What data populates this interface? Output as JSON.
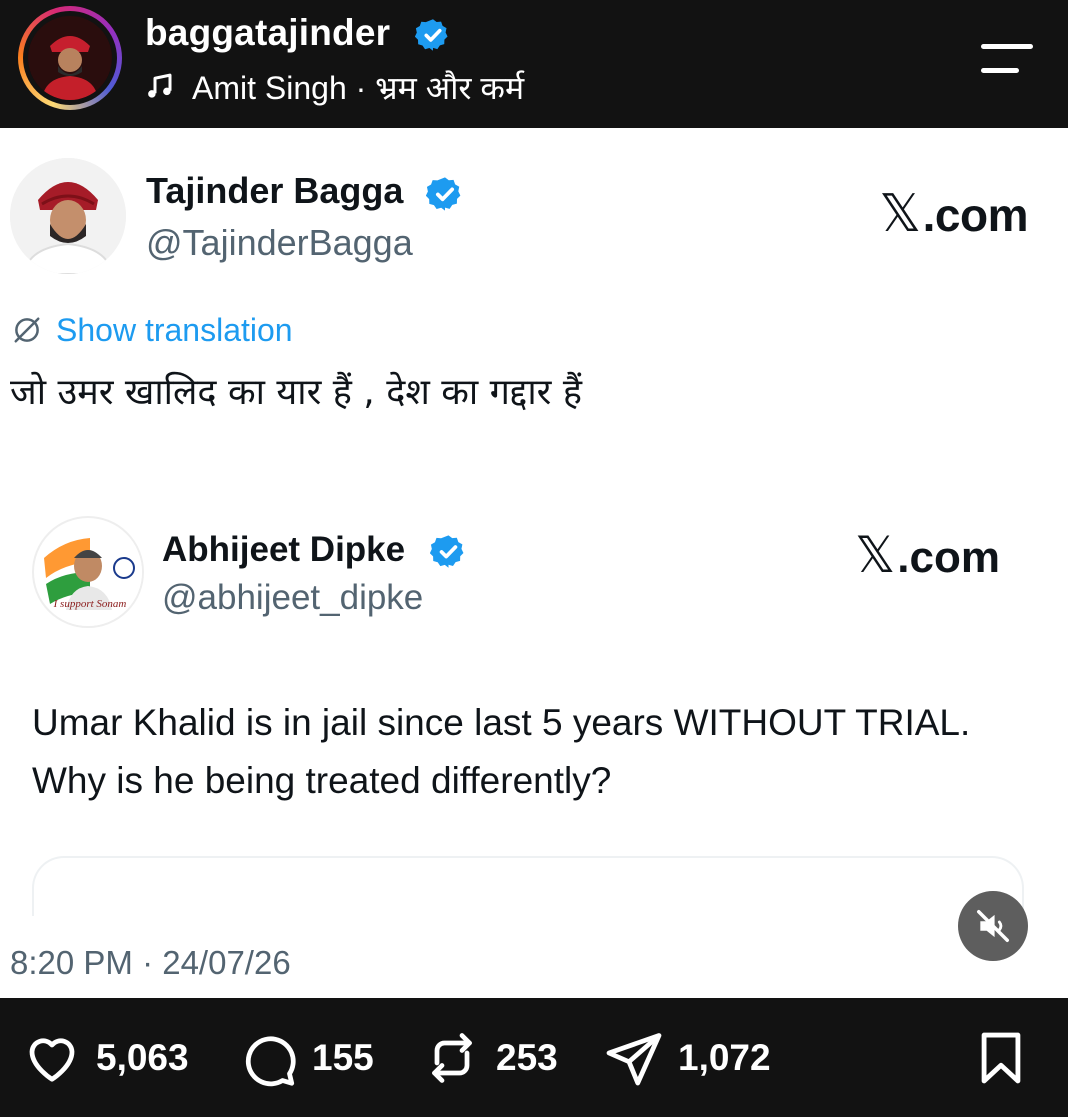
{
  "header": {
    "username": "baggatajinder",
    "music_text": "Amit Singh · भ्रम और कर्म"
  },
  "tweet": {
    "author_name": "Tajinder Bagga",
    "author_handle": "@TajinderBagga",
    "platform_label": "X.com",
    "show_translation_label": "Show translation",
    "text": "जो उमर खालिद का यार हैं , देश का गद्दार हैं",
    "timestamp": "8:20 PM · 24/07/26"
  },
  "quoted_tweet": {
    "author_name": "Abhijeet Dipke",
    "author_handle": "@abhijeet_dipke",
    "platform_label": "X.com",
    "avatar_caption": "I support Sonam",
    "text": "Umar Khalid is in jail since last 5 years WITHOUT TRIAL. Why is he being treated differently?"
  },
  "actions": {
    "likes": "5,063",
    "comments": "155",
    "reposts": "253",
    "shares": "1,072"
  },
  "icons": {
    "verified": "verified-badge-icon",
    "music": "music-note-icon",
    "menu": "hamburger-menu-icon",
    "translate": "translate-globe-icon",
    "mute": "speaker-muted-icon",
    "like": "heart-icon",
    "comment": "comment-bubble-icon",
    "repost": "repost-icon",
    "share": "send-icon",
    "save": "bookmark-icon"
  },
  "colors": {
    "header_bg": "#121212",
    "verified_blue": "#1d9bf0",
    "link_blue": "#1d9bf0",
    "muted_text": "#536471"
  }
}
